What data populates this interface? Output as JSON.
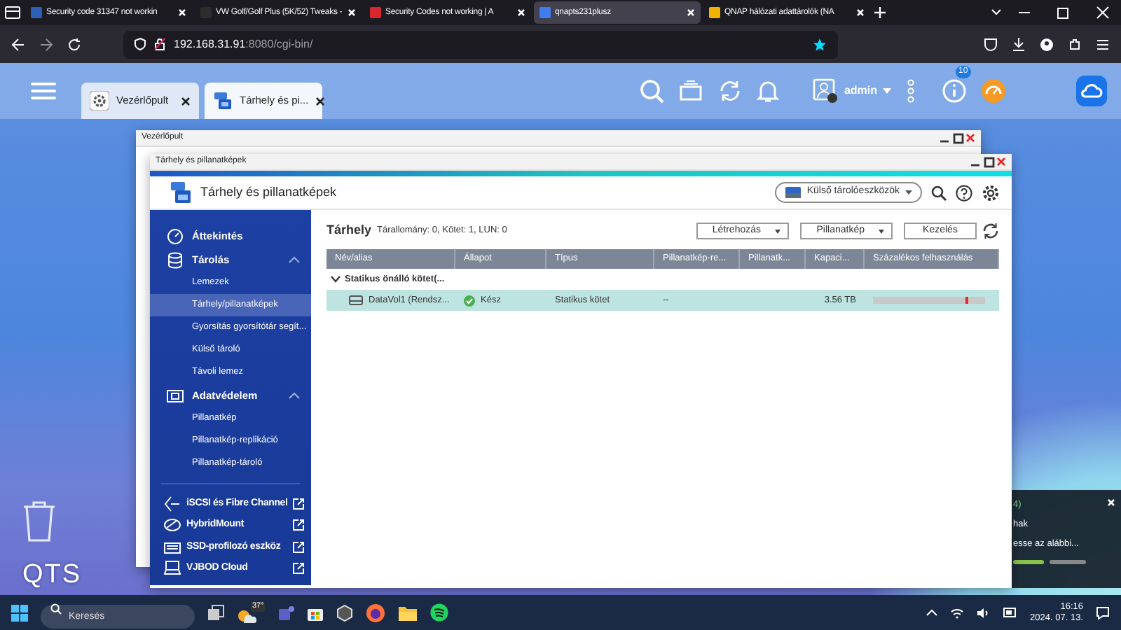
{
  "browser": {
    "tabs": [
      {
        "title": "Security code 31347 not workin",
        "selected": false
      },
      {
        "title": "VW Golf/Golf Plus (5K/52) Tweaks -",
        "selected": false
      },
      {
        "title": "Security Codes not working | A",
        "selected": false
      },
      {
        "title": "qnapts231plusz",
        "selected": true
      },
      {
        "title": "QNAP hálózati adattárolók (NA",
        "selected": false
      }
    ],
    "url_host": "192.168.31.91",
    "url_path": ":8080/cgi-bin/"
  },
  "qts": {
    "app_tabs": [
      {
        "label": "Vezérlőpult",
        "selected": false
      },
      {
        "label": "Tárhely és pi...",
        "selected": true
      }
    ],
    "user": "admin",
    "badge": "10",
    "label": "QTS"
  },
  "back_window": {
    "title": "Vezérlőpult"
  },
  "window": {
    "title": "Tárhely és pillanatképek",
    "heading": "Tárhely és pillanatképek",
    "external_button": "Külső tárolóeszközök",
    "sidebar": {
      "groups": [
        {
          "label": "Áttekintés",
          "selected": false
        },
        {
          "label": "Tárolás",
          "selected": false,
          "expanded": true,
          "children": [
            {
              "label": "Lemezek",
              "selected": false
            },
            {
              "label": "Tárhely/pillanatképek",
              "selected": true
            },
            {
              "label": "Gyorsítás gyorsítótár segít...",
              "selected": false
            },
            {
              "label": "Külső tároló",
              "selected": false
            },
            {
              "label": "Távoli lemez",
              "selected": false
            }
          ]
        },
        {
          "label": "Adatvédelem",
          "selected": false,
          "expanded": true,
          "children": [
            {
              "label": "Pillanatkép",
              "selected": false
            },
            {
              "label": "Pillanatkép-replikáció",
              "selected": false
            },
            {
              "label": "Pillanatkép-tároló",
              "selected": false
            }
          ]
        }
      ],
      "links": [
        {
          "label": "iSCSI és Fibre Channel"
        },
        {
          "label": "HybridMount"
        },
        {
          "label": "SSD-profilozó eszköz"
        },
        {
          "label": "VJBOD Cloud"
        }
      ]
    },
    "content": {
      "title": "Tárhely",
      "summary": "Tárallomány: 0, Kötet: 1, LUN: 0",
      "buttons": [
        {
          "label": "Létrehozás",
          "kind": "dropdown"
        },
        {
          "label": "Pillanatkép",
          "kind": "dropdown"
        },
        {
          "label": "Kezelés",
          "kind": "plain"
        }
      ],
      "table": {
        "columns": [
          "Név/alias",
          "Állapot",
          "Típus",
          "Pillanatkép-re...",
          "Pillanatk...",
          "Kapaci...",
          "Százalékos felhasználás"
        ],
        "groups": [
          {
            "label": "Statikus önálló kötet(...",
            "expanded": true,
            "rows": [
              {
                "name": "DataVol1 (Rendsz...",
                "status": "Kész",
                "type": "Statikus kötet",
                "column_4": "--",
                "capacity": "3.56 TB",
                "level": 0.82,
                "selected": true
              }
            ]
          }
        ]
      }
    }
  },
  "notification": {
    "lines": [
      "4)",
      "hak",
      "esse az alábbi..."
    ]
  },
  "taskbar": {
    "search_placeholder": "Keresés",
    "weather": "37°",
    "time": "16:16",
    "date": "2024. 07. 13."
  }
}
